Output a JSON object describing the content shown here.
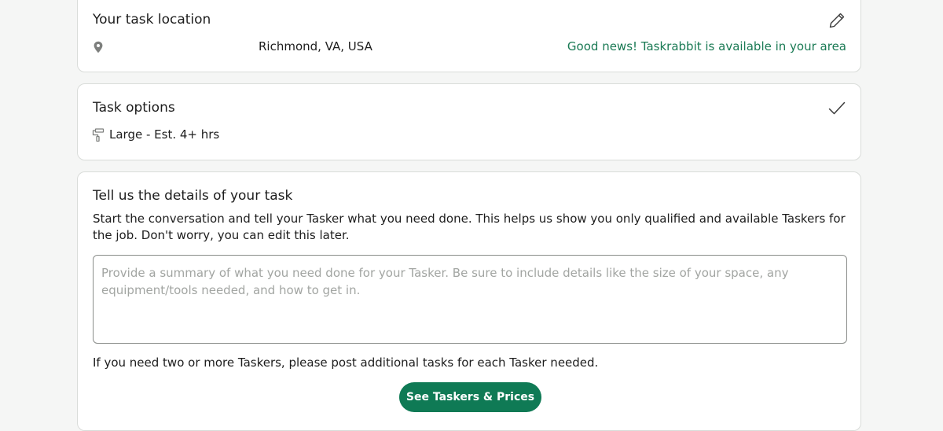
{
  "location_card": {
    "title": "Your task location",
    "address": "Richmond, VA, USA",
    "availability": "Good news! Taskrabbit is available in your area",
    "edit_icon": "pencil-icon",
    "pin_icon": "map-pin-icon"
  },
  "options_card": {
    "title": "Task options",
    "option_value": "Large - Est. 4+ hrs",
    "option_icon": "paint-roller-icon",
    "status_icon": "checkmark-icon"
  },
  "details_card": {
    "title": "Tell us the details of your task",
    "description": "Start the conversation and tell your Tasker what you need done. This helps us show you only qualified and available Taskers for the job. Don't worry, you can edit this later.",
    "textarea_value": "",
    "textarea_placeholder": "Provide a summary of what you need done for your Tasker. Be sure to include details like the size of your space, any equipment/tools needed, and how to get in.",
    "note": "If you need two or more Taskers, please post additional tasks for each Tasker needed.",
    "cta_label": "See Taskers & Prices"
  },
  "colors": {
    "brand_green": "#0f7a55",
    "success_text": "#1a7a54",
    "page_background": "#f5f6f5"
  }
}
